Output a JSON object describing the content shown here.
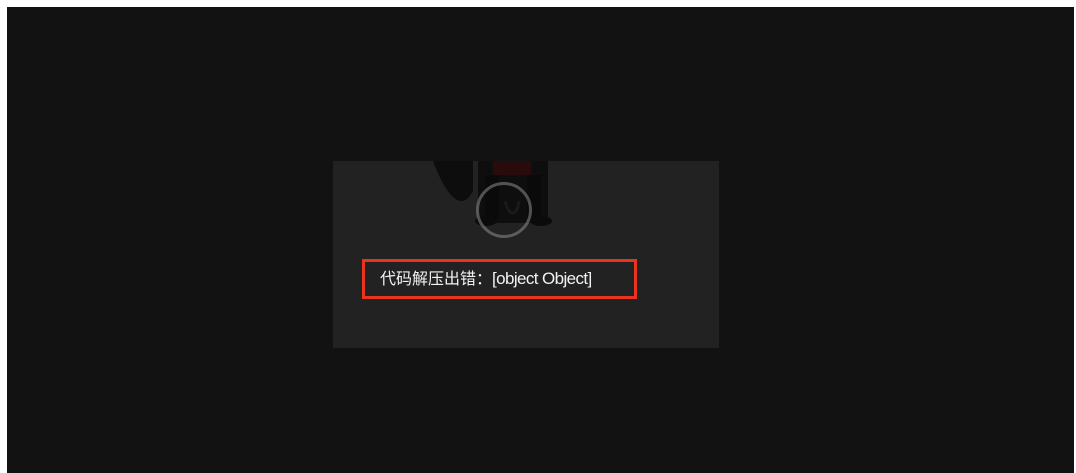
{
  "loading_panel": {
    "error_label": "代码解压出错：",
    "error_value": "[object Object]",
    "colors": {
      "background": "#121212",
      "panel": "#222222",
      "highlight_border": "#e8341c",
      "text": "#f2f2f2"
    },
    "icons": {
      "illustration": "character-illustration-icon",
      "spinner": "loading-spinner-icon"
    }
  }
}
